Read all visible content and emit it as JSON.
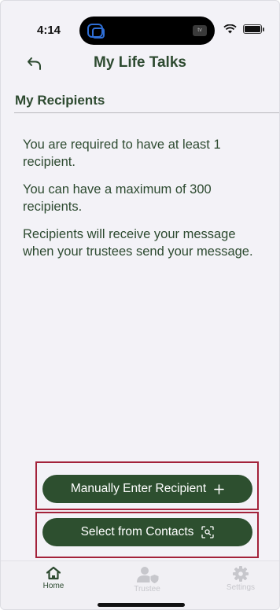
{
  "status_bar": {
    "time": "4:14",
    "island_badge": "tv"
  },
  "header": {
    "title": "My Life Talks"
  },
  "section": {
    "title": "My Recipients"
  },
  "info": {
    "line1": "You are required to have at least 1 recipient.",
    "line2": "You can have a maximum of 300 recipients.",
    "line3": "Recipients will receive your message when your trustees send your message."
  },
  "actions": {
    "manual_label": "Manually Enter Recipient",
    "contacts_label": "Select from Contacts"
  },
  "tabs": [
    {
      "label": "Home",
      "icon": "home-icon",
      "active": true
    },
    {
      "label": "Trustee",
      "icon": "trustee-icon",
      "active": false
    },
    {
      "label": "Settings",
      "icon": "gear-icon",
      "active": false
    }
  ],
  "colors": {
    "primary": "#2d4f2f",
    "text": "#2d4a30",
    "highlight": "#a3223a",
    "background": "#f3f2f7"
  }
}
